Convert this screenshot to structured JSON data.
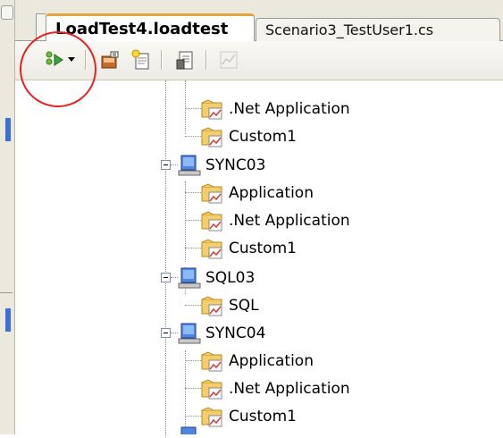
{
  "tabs": [
    {
      "label": "LoadTest4.loadtest",
      "active": true
    },
    {
      "label": "Scenario3_TestUser1.cs",
      "active": false
    }
  ],
  "toolbar": {
    "buttons": [
      {
        "name": "run-test",
        "icon": "run-test-icon"
      },
      {
        "name": "run-dropdown",
        "icon": "chevron-down-icon"
      },
      {
        "name": "manage-counter-sets",
        "icon": "counter-sets-icon"
      },
      {
        "name": "add-scenario",
        "icon": "add-scenario-icon"
      },
      {
        "name": "properties",
        "icon": "properties-icon"
      },
      {
        "name": "graph",
        "icon": "graph-icon"
      }
    ]
  },
  "tree": [
    {
      "type": "leaf",
      "label": ".Net Application"
    },
    {
      "type": "leaf",
      "label": "Custom1"
    },
    {
      "type": "computer",
      "label": "SYNC03"
    },
    {
      "type": "leaf",
      "label": "Application"
    },
    {
      "type": "leaf",
      "label": ".Net Application"
    },
    {
      "type": "leaf",
      "label": "Custom1"
    },
    {
      "type": "computer",
      "label": "SQL03"
    },
    {
      "type": "leaf",
      "label": "SQL"
    },
    {
      "type": "computer",
      "label": "SYNC04"
    },
    {
      "type": "leaf",
      "label": "Application"
    },
    {
      "type": "leaf",
      "label": ".Net Application"
    },
    {
      "type": "leaf",
      "label": "Custom1"
    }
  ],
  "colors": {
    "annotation": "#e32424",
    "tab_active_accent": "#e6a23c"
  }
}
